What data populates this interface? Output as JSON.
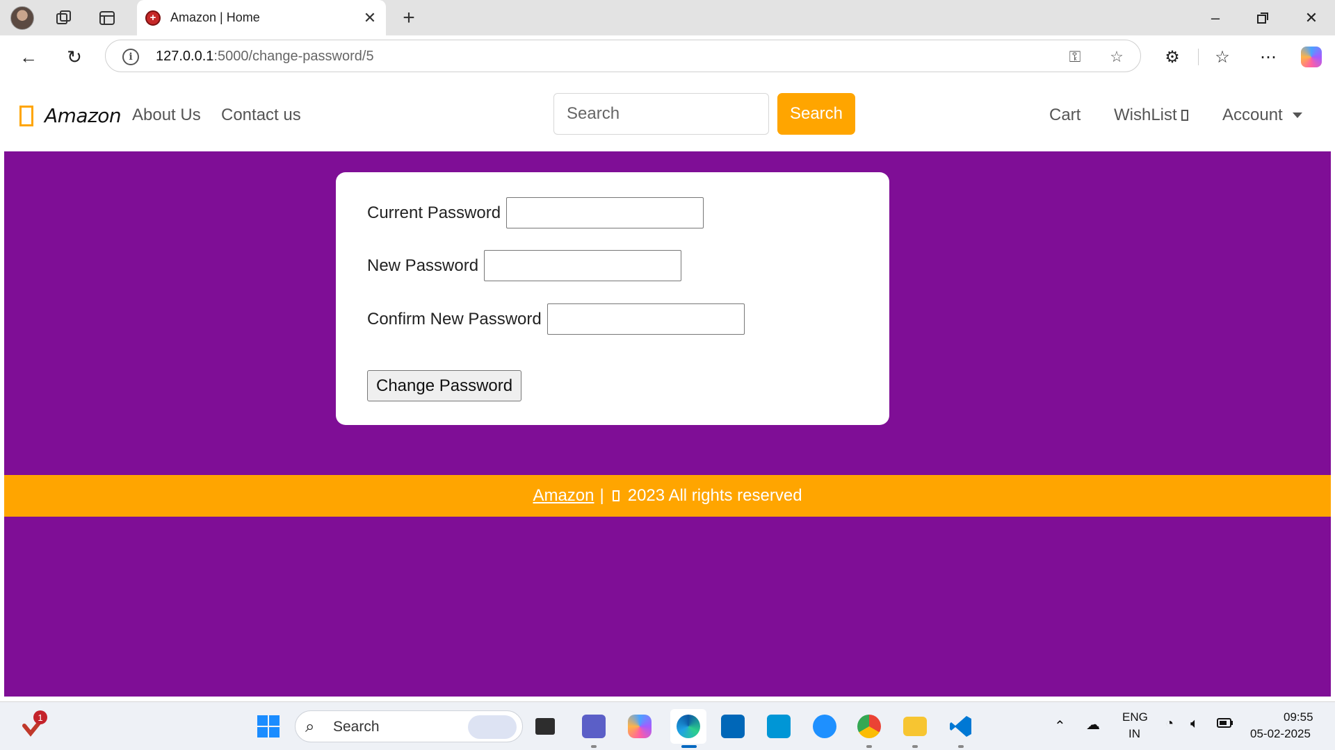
{
  "browser": {
    "tab_title": "Amazon | Home",
    "url_host": "127.0.0.1",
    "url_path": ":5000/change-password/5",
    "icons": [
      "profile-avatar",
      "workspaces-icon",
      "tab-actions-icon",
      "close-icon",
      "new-tab-icon",
      "minimize-icon",
      "restore-icon",
      "close-window-icon",
      "back-icon",
      "refresh-icon",
      "info-icon",
      "key-icon",
      "star-icon",
      "extensions-icon",
      "favorites-icon",
      "more-icon",
      "copilot-icon"
    ]
  },
  "navbar": {
    "brand": "Amazon",
    "links": [
      "About Us",
      "Contact us"
    ],
    "search_placeholder": "Search",
    "search_button": "Search",
    "cart": "Cart",
    "wishlist": "WishList",
    "account": "Account"
  },
  "form": {
    "current_label": "Current Password",
    "new_label": "New Password",
    "confirm_label": "Confirm New Password",
    "submit": "Change Password"
  },
  "footer": {
    "link": "Amazon",
    "separator": "|",
    "text": "2023 All rights reserved"
  },
  "taskbar": {
    "search_label": "Search",
    "notification_count": "1",
    "language": "ENG",
    "region": "IN",
    "time": "09:55",
    "date": "05-02-2025"
  },
  "colors": {
    "page_background": "#7f0e96",
    "accent": "#ffa500",
    "card": "#ffffff"
  }
}
